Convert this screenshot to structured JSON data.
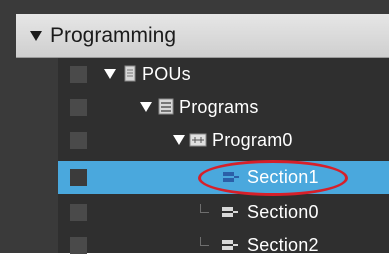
{
  "header": {
    "title": "Programming"
  },
  "tree": [
    {
      "label": "POUs",
      "icon": "pous-icon"
    },
    {
      "label": "Programs",
      "icon": "programs-icon"
    },
    {
      "label": "Program0",
      "icon": "program-icon"
    },
    {
      "label": "Section1",
      "icon": "section-icon",
      "selected": true
    },
    {
      "label": "Section0",
      "icon": "section-icon"
    },
    {
      "label": "Section2",
      "icon": "section-icon"
    }
  ],
  "colors": {
    "selection": "#4aa8dd",
    "annotation": "#d6202a"
  }
}
